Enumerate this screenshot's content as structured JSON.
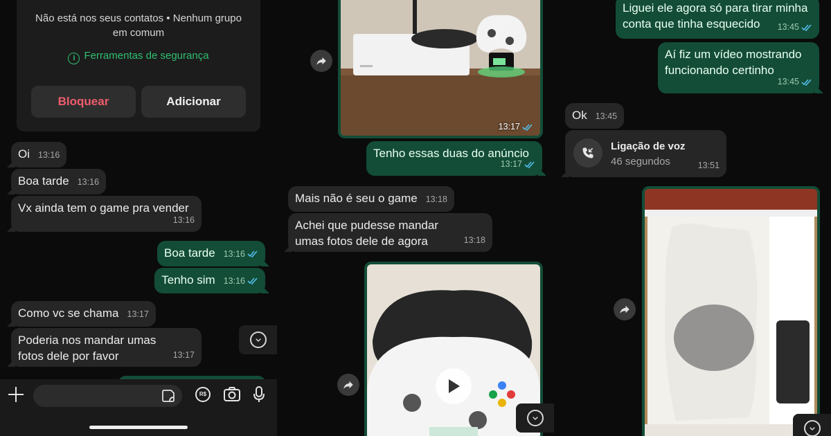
{
  "panel1": {
    "contact_info": "Não está nos seus contatos • Nenhum grupo em comum",
    "safety_tools": "Ferramentas de segurança",
    "block_label": "Bloquear",
    "add_label": "Adicionar",
    "messages": [
      {
        "text": "Oi",
        "time": "13:16"
      },
      {
        "text": "Boa tarde",
        "time": "13:16"
      },
      {
        "text": "Vx ainda tem o game pra vender",
        "time": "13:16"
      },
      {
        "text": "Boa tarde",
        "time": "13:16"
      },
      {
        "text": "Tenho sim",
        "time": "13:16"
      },
      {
        "text": "Como vc se chama",
        "time": "13:17"
      },
      {
        "text": "Poderia nos mandar umas fotos dele por favor",
        "time": "13:17"
      }
    ]
  },
  "panel2": {
    "photo_time": "13:17",
    "messages": [
      {
        "text": "Tenho essas duas do anúncio",
        "time": "13:17"
      },
      {
        "text": "Mais não é seu o game",
        "time": "13:18"
      },
      {
        "text": "Achei que pudesse mandar umas fotos dele de agora",
        "time": "13:18"
      }
    ]
  },
  "panel3": {
    "messages": [
      {
        "text": "Liguei ele agora só para tirar minha conta que tinha esquecido",
        "time": "13:45"
      },
      {
        "text": "Aí fiz um vídeo mostrando funcionando certinho",
        "time": "13:45"
      },
      {
        "text": "Ok",
        "time": "13:45"
      }
    ],
    "call": {
      "title": "Ligação de voz",
      "duration": "46 segundos",
      "time": "13:51"
    }
  },
  "colors": {
    "outgoing": "#134d37",
    "incoming": "#262626",
    "accent": "#2fbf71",
    "danger": "#f15c6d",
    "read_ticks": "#53bdeb"
  },
  "icons": [
    "info-icon",
    "forward-icon",
    "scroll-down-icon",
    "plus-icon",
    "sticker-icon",
    "payment-icon",
    "camera-icon",
    "microphone-icon",
    "play-icon",
    "missed-call-icon",
    "double-check-icon"
  ]
}
